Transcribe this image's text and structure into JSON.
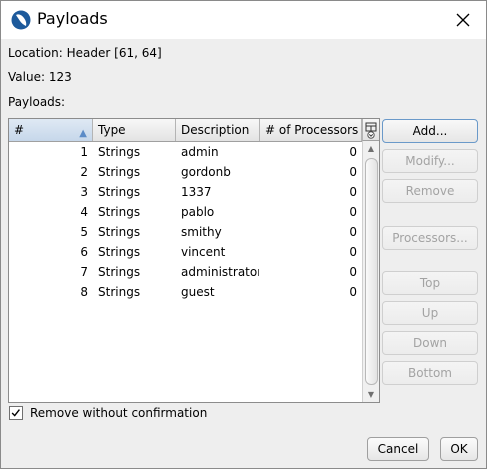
{
  "window": {
    "title": "Payloads"
  },
  "info": {
    "location_label": "Location:",
    "location_value": "Header [61, 64]",
    "value_label": "Value:",
    "value_value": "123",
    "payloads_label": "Payloads:"
  },
  "table": {
    "columns": [
      "#",
      "Type",
      "Description",
      "# of Processors"
    ],
    "rows": [
      {
        "num": "1",
        "type": "Strings",
        "description": "admin",
        "processors": "0"
      },
      {
        "num": "2",
        "type": "Strings",
        "description": "gordonb",
        "processors": "0"
      },
      {
        "num": "3",
        "type": "Strings",
        "description": "1337",
        "processors": "0"
      },
      {
        "num": "4",
        "type": "Strings",
        "description": "pablo",
        "processors": "0"
      },
      {
        "num": "5",
        "type": "Strings",
        "description": "smithy",
        "processors": "0"
      },
      {
        "num": "6",
        "type": "Strings",
        "description": "vincent",
        "processors": "0"
      },
      {
        "num": "7",
        "type": "Strings",
        "description": "administrator",
        "processors": "0"
      },
      {
        "num": "8",
        "type": "Strings",
        "description": "guest",
        "processors": "0"
      }
    ]
  },
  "side_buttons": {
    "add": "Add...",
    "modify": "Modify...",
    "remove": "Remove",
    "processors": "Processors...",
    "top": "Top",
    "up": "Up",
    "down": "Down",
    "bottom": "Bottom"
  },
  "options": {
    "remove_without_confirmation": "Remove without confirmation",
    "checked": true
  },
  "footer": {
    "cancel": "Cancel",
    "ok": "OK"
  },
  "colors": {
    "accent": "#5b8bc7",
    "background": "#eeeeee"
  }
}
